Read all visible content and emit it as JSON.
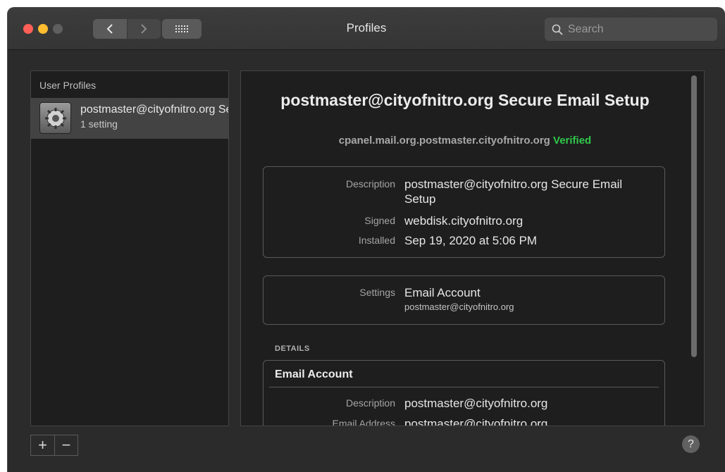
{
  "window": {
    "title": "Profiles"
  },
  "search": {
    "placeholder": "Search"
  },
  "sidebar": {
    "header": "User Profiles",
    "items": [
      {
        "name": "postmaster@cityofnitro.org Secure Email Setup",
        "sub": "1 setting"
      }
    ]
  },
  "detail": {
    "title": "postmaster@cityofnitro.org Secure Email Setup",
    "subtitle": "cpanel.mail.org.postmaster.cityofnitro.org",
    "verified": "Verified",
    "summary": {
      "description_label": "Description",
      "description": "postmaster@cityofnitro.org Secure Email Setup",
      "signed_label": "Signed",
      "signed": "webdisk.cityofnitro.org",
      "installed_label": "Installed",
      "installed": "Sep 19, 2020 at 5:06 PM"
    },
    "settings": {
      "label": "Settings",
      "value": "Email Account",
      "sub": "postmaster@cityofnitro.org"
    },
    "details_label": "DETAILS",
    "account": {
      "heading": "Email Account",
      "description_label": "Description",
      "description": "postmaster@cityofnitro.org",
      "email_label": "Email Address",
      "email": "postmaster@cityofnitro.org"
    }
  },
  "footer": {
    "add": "+",
    "remove": "−",
    "help": "?"
  },
  "colors": {
    "verified": "#2fc84a",
    "close": "#fe5f57",
    "minimize": "#febc2e"
  }
}
